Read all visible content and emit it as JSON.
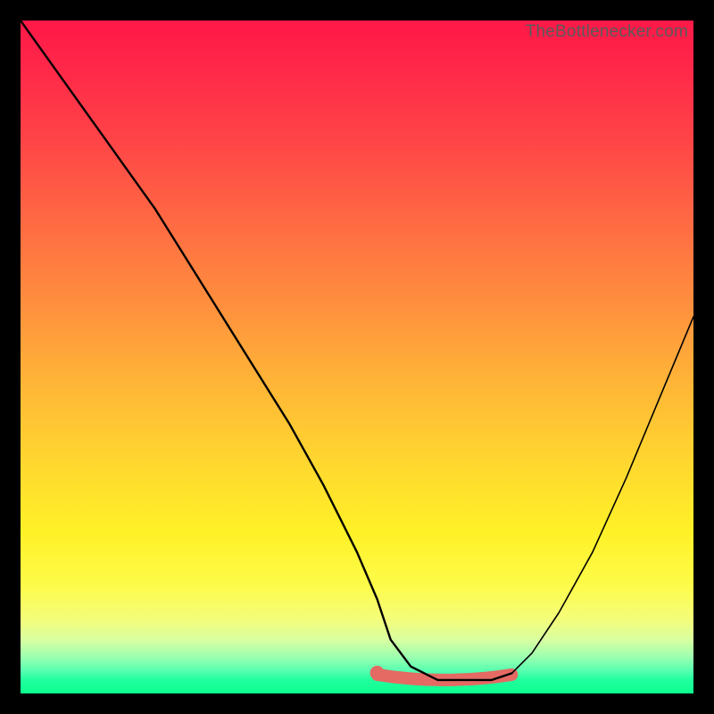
{
  "watermark": "TheBottlenecker.com",
  "colors": {
    "frame": "#000000",
    "curve": "#000000",
    "trough": "#e46a63",
    "gradient_top": "#ff1848",
    "gradient_bottom": "#0cff8e"
  },
  "chart_data": {
    "type": "line",
    "title": "",
    "xlabel": "",
    "ylabel": "",
    "xlim": [
      0,
      100
    ],
    "ylim": [
      0,
      100
    ],
    "grid": false,
    "legend": false,
    "series": [
      {
        "name": "bottleneck-curve",
        "x": [
          0,
          5,
          10,
          15,
          20,
          25,
          30,
          35,
          40,
          45,
          50,
          53,
          55,
          58,
          62,
          66,
          70,
          73,
          76,
          80,
          85,
          90,
          95,
          100
        ],
        "values": [
          100,
          93,
          86,
          79,
          72,
          64,
          56,
          48,
          40,
          31,
          21,
          14,
          8,
          4,
          2,
          2,
          2,
          3,
          6,
          12,
          21,
          32,
          44,
          56
        ]
      }
    ],
    "annotations": [
      {
        "name": "optimal-range-marker",
        "x_start": 53,
        "x_end": 73,
        "y": 2,
        "color": "#e46a63"
      }
    ]
  }
}
